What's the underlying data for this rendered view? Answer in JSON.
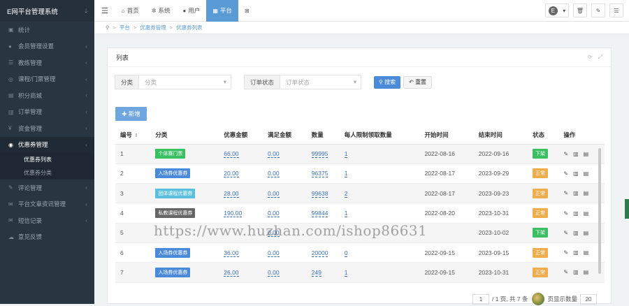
{
  "brand": {
    "title": "E网平台管理系统",
    "icon": "water-drop-icon"
  },
  "sidebar": {
    "items": [
      {
        "label": "统计",
        "icon": "dashboard-icon",
        "arrow": false
      },
      {
        "label": "会员管理设置",
        "icon": "user-icon",
        "arrow": true
      },
      {
        "label": "教练管理",
        "icon": "people-icon",
        "arrow": true
      },
      {
        "label": "课程/门票管理",
        "icon": "ticket-icon",
        "arrow": true
      },
      {
        "label": "积分商城",
        "icon": "gift-icon",
        "arrow": true
      },
      {
        "label": "订单管理",
        "icon": "chart-icon",
        "arrow": true
      },
      {
        "label": "资金管理",
        "icon": "yen-icon",
        "arrow": true
      },
      {
        "label": "优惠券管理",
        "icon": "coupon-icon",
        "arrow": true,
        "active": true
      },
      {
        "label": "优惠券列表",
        "sub": true,
        "on": true
      },
      {
        "label": "优惠券分类",
        "sub": true
      },
      {
        "label": "评论管理",
        "icon": "comment-icon",
        "arrow": true
      },
      {
        "label": "平台文章资讯管理",
        "icon": "article-icon",
        "arrow": true
      },
      {
        "label": "短信记录",
        "icon": "mail-icon",
        "arrow": true
      },
      {
        "label": "意见反馈",
        "icon": "feedback-icon",
        "arrow": false
      }
    ]
  },
  "topbar": {
    "tabs": [
      {
        "label": "首页",
        "icon": "home-icon"
      },
      {
        "label": "系统",
        "icon": "gear-icon"
      },
      {
        "label": "用户",
        "icon": "user-icon"
      },
      {
        "label": "平台",
        "icon": "grid-icon",
        "active": true
      },
      {
        "label": "",
        "icon": "apps-icon"
      }
    ],
    "user_initial": "E"
  },
  "breadcrumb": [
    "平台",
    "优惠券管理",
    "优惠券列表"
  ],
  "panel": {
    "title": "列表"
  },
  "filters": {
    "category_label": "分类",
    "category_placeholder": "分类",
    "status_label": "订单状态",
    "status_placeholder": "订单状态",
    "search_label": "搜索",
    "reset_label": "重置"
  },
  "add_label": "新增",
  "table": {
    "headers": [
      "编号",
      "分类",
      "优惠金额",
      "满足金额",
      "数量",
      "每人限制领取数量",
      "开始时间",
      "结束时间",
      "状态",
      "操作"
    ],
    "rows": [
      {
        "id": "1",
        "tag": "个体赛门票",
        "tag_color": "#3cbf63",
        "amount": "66.00",
        "min": "0.00",
        "qty": "99995",
        "limit": "1",
        "start": "2022-08-16",
        "end": "2022-09-16",
        "status": "下架",
        "status_color": "#3cbf63"
      },
      {
        "id": "2",
        "tag": "入场券优惠券",
        "tag_color": "#4a8ad8",
        "amount": "20.00",
        "min": "0.00",
        "qty": "96375",
        "limit": "1",
        "start": "2022-08-17",
        "end": "2023-09-29",
        "status": "正常",
        "status_color": "#f0ad4e"
      },
      {
        "id": "3",
        "tag": "团体课程优惠券",
        "tag_color": "#5bc0de",
        "amount": "28.00",
        "min": "0.00",
        "qty": "99638",
        "limit": "2",
        "start": "2022-08-17",
        "end": "2023-09-23",
        "status": "正常",
        "status_color": "#f0ad4e"
      },
      {
        "id": "4",
        "tag": "私教课程优惠券",
        "tag_color": "#666666",
        "amount": "190.00",
        "min": "0.00",
        "qty": "99844",
        "limit": "1",
        "start": "2022-08-20",
        "end": "2023-10-31",
        "status": "正常",
        "status_color": "#f0ad4e"
      },
      {
        "id": "5",
        "tag": "",
        "tag_color": "#666666",
        "amount": "",
        "min": "0.00",
        "qty": "",
        "limit": "",
        "start": "",
        "end": "2023-10-02",
        "status": "下架",
        "status_color": "#3cbf63"
      },
      {
        "id": "6",
        "tag": "入场券优惠券",
        "tag_color": "#4a8ad8",
        "amount": "36.00",
        "min": "0.00",
        "qty": "20000",
        "limit": "0",
        "start": "2022-09-15",
        "end": "2023-09-15",
        "status": "正常",
        "status_color": "#f0ad4e"
      },
      {
        "id": "7",
        "tag": "入场券优惠券",
        "tag_color": "#4a8ad8",
        "amount": "26.00",
        "min": "0.00",
        "qty": "249",
        "limit": "1",
        "start": "2022-09-15",
        "end": "2023-10-31",
        "status": "正常",
        "status_color": "#f0ad4e"
      }
    ]
  },
  "pager": {
    "page": "1",
    "info": "/ 1 页, 共 7 条",
    "per_page_label": "页显示数量",
    "per_page": "20"
  },
  "watermark": "https://www.huzhan.com/ishop86631"
}
